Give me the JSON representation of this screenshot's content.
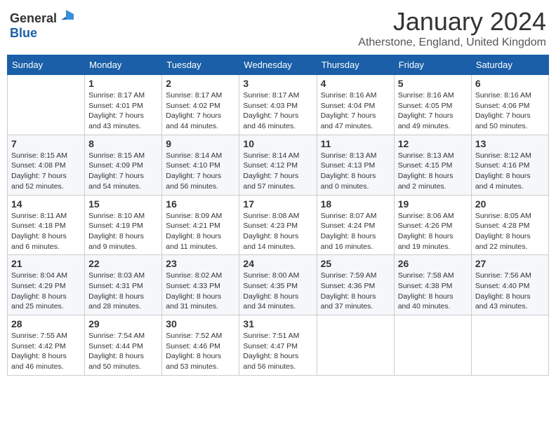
{
  "logo": {
    "text_general": "General",
    "text_blue": "Blue"
  },
  "title": "January 2024",
  "location": "Atherstone, England, United Kingdom",
  "weekdays": [
    "Sunday",
    "Monday",
    "Tuesday",
    "Wednesday",
    "Thursday",
    "Friday",
    "Saturday"
  ],
  "weeks": [
    [
      {
        "day": "",
        "info": ""
      },
      {
        "day": "1",
        "info": "Sunrise: 8:17 AM\nSunset: 4:01 PM\nDaylight: 7 hours\nand 43 minutes."
      },
      {
        "day": "2",
        "info": "Sunrise: 8:17 AM\nSunset: 4:02 PM\nDaylight: 7 hours\nand 44 minutes."
      },
      {
        "day": "3",
        "info": "Sunrise: 8:17 AM\nSunset: 4:03 PM\nDaylight: 7 hours\nand 46 minutes."
      },
      {
        "day": "4",
        "info": "Sunrise: 8:16 AM\nSunset: 4:04 PM\nDaylight: 7 hours\nand 47 minutes."
      },
      {
        "day": "5",
        "info": "Sunrise: 8:16 AM\nSunset: 4:05 PM\nDaylight: 7 hours\nand 49 minutes."
      },
      {
        "day": "6",
        "info": "Sunrise: 8:16 AM\nSunset: 4:06 PM\nDaylight: 7 hours\nand 50 minutes."
      }
    ],
    [
      {
        "day": "7",
        "info": "Sunrise: 8:15 AM\nSunset: 4:08 PM\nDaylight: 7 hours\nand 52 minutes."
      },
      {
        "day": "8",
        "info": "Sunrise: 8:15 AM\nSunset: 4:09 PM\nDaylight: 7 hours\nand 54 minutes."
      },
      {
        "day": "9",
        "info": "Sunrise: 8:14 AM\nSunset: 4:10 PM\nDaylight: 7 hours\nand 56 minutes."
      },
      {
        "day": "10",
        "info": "Sunrise: 8:14 AM\nSunset: 4:12 PM\nDaylight: 7 hours\nand 57 minutes."
      },
      {
        "day": "11",
        "info": "Sunrise: 8:13 AM\nSunset: 4:13 PM\nDaylight: 8 hours\nand 0 minutes."
      },
      {
        "day": "12",
        "info": "Sunrise: 8:13 AM\nSunset: 4:15 PM\nDaylight: 8 hours\nand 2 minutes."
      },
      {
        "day": "13",
        "info": "Sunrise: 8:12 AM\nSunset: 4:16 PM\nDaylight: 8 hours\nand 4 minutes."
      }
    ],
    [
      {
        "day": "14",
        "info": "Sunrise: 8:11 AM\nSunset: 4:18 PM\nDaylight: 8 hours\nand 6 minutes."
      },
      {
        "day": "15",
        "info": "Sunrise: 8:10 AM\nSunset: 4:19 PM\nDaylight: 8 hours\nand 9 minutes."
      },
      {
        "day": "16",
        "info": "Sunrise: 8:09 AM\nSunset: 4:21 PM\nDaylight: 8 hours\nand 11 minutes."
      },
      {
        "day": "17",
        "info": "Sunrise: 8:08 AM\nSunset: 4:23 PM\nDaylight: 8 hours\nand 14 minutes."
      },
      {
        "day": "18",
        "info": "Sunrise: 8:07 AM\nSunset: 4:24 PM\nDaylight: 8 hours\nand 16 minutes."
      },
      {
        "day": "19",
        "info": "Sunrise: 8:06 AM\nSunset: 4:26 PM\nDaylight: 8 hours\nand 19 minutes."
      },
      {
        "day": "20",
        "info": "Sunrise: 8:05 AM\nSunset: 4:28 PM\nDaylight: 8 hours\nand 22 minutes."
      }
    ],
    [
      {
        "day": "21",
        "info": "Sunrise: 8:04 AM\nSunset: 4:29 PM\nDaylight: 8 hours\nand 25 minutes."
      },
      {
        "day": "22",
        "info": "Sunrise: 8:03 AM\nSunset: 4:31 PM\nDaylight: 8 hours\nand 28 minutes."
      },
      {
        "day": "23",
        "info": "Sunrise: 8:02 AM\nSunset: 4:33 PM\nDaylight: 8 hours\nand 31 minutes."
      },
      {
        "day": "24",
        "info": "Sunrise: 8:00 AM\nSunset: 4:35 PM\nDaylight: 8 hours\nand 34 minutes."
      },
      {
        "day": "25",
        "info": "Sunrise: 7:59 AM\nSunset: 4:36 PM\nDaylight: 8 hours\nand 37 minutes."
      },
      {
        "day": "26",
        "info": "Sunrise: 7:58 AM\nSunset: 4:38 PM\nDaylight: 8 hours\nand 40 minutes."
      },
      {
        "day": "27",
        "info": "Sunrise: 7:56 AM\nSunset: 4:40 PM\nDaylight: 8 hours\nand 43 minutes."
      }
    ],
    [
      {
        "day": "28",
        "info": "Sunrise: 7:55 AM\nSunset: 4:42 PM\nDaylight: 8 hours\nand 46 minutes."
      },
      {
        "day": "29",
        "info": "Sunrise: 7:54 AM\nSunset: 4:44 PM\nDaylight: 8 hours\nand 50 minutes."
      },
      {
        "day": "30",
        "info": "Sunrise: 7:52 AM\nSunset: 4:46 PM\nDaylight: 8 hours\nand 53 minutes."
      },
      {
        "day": "31",
        "info": "Sunrise: 7:51 AM\nSunset: 4:47 PM\nDaylight: 8 hours\nand 56 minutes."
      },
      {
        "day": "",
        "info": ""
      },
      {
        "day": "",
        "info": ""
      },
      {
        "day": "",
        "info": ""
      }
    ]
  ]
}
